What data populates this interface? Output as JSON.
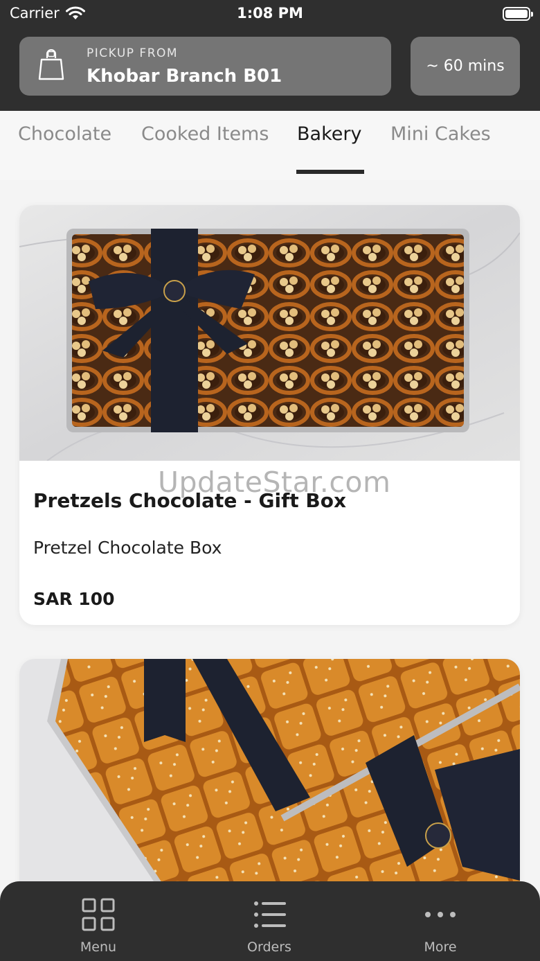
{
  "status_bar": {
    "carrier": "Carrier",
    "time": "1:08 PM"
  },
  "pickup": {
    "label": "PICKUP FROM",
    "branch": "Khobar Branch B01",
    "icon": "shopping-bag-icon"
  },
  "eta": "~ 60 mins",
  "tabs": [
    {
      "label": "Chocolate"
    },
    {
      "label": "Cooked Items"
    },
    {
      "label": "Bakery",
      "active": true
    },
    {
      "label": "Mini Cakes"
    }
  ],
  "products": [
    {
      "title": "Pretzels Chocolate - Gift Box",
      "description": "Pretzel Chocolate Box",
      "price": "SAR 100"
    },
    {
      "title": "",
      "description": "",
      "price": ""
    }
  ],
  "watermark": "UpdateStar.com",
  "bottom_nav": [
    {
      "label": "Menu",
      "icon": "grid-icon"
    },
    {
      "label": "Orders",
      "icon": "list-icon"
    },
    {
      "label": "More",
      "icon": "more-dots-icon"
    }
  ]
}
